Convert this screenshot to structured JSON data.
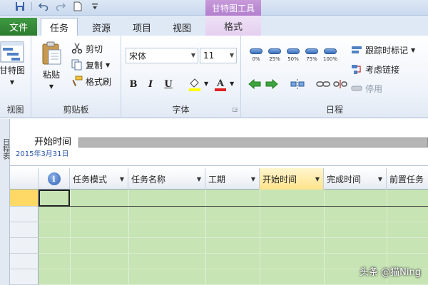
{
  "context_tab_header": "甘特图工具",
  "tabs": {
    "file": "文件",
    "task": "任务",
    "resource": "资源",
    "project": "项目",
    "view": "视图",
    "format": "格式"
  },
  "ribbon": {
    "view_group": {
      "button_label": "甘特图",
      "label": "视图"
    },
    "clipboard": {
      "paste": "粘贴",
      "cut": "剪切",
      "copy": "复制",
      "format_painter": "格式刷",
      "label": "剪贴板"
    },
    "font": {
      "font_name": "宋体",
      "font_size": "11",
      "bold": "B",
      "italic": "I",
      "underline": "U",
      "label": "字体"
    },
    "schedule": {
      "percent_buttons": [
        "0%",
        "25%",
        "50%",
        "75%",
        "100%"
      ],
      "mark_on_track": "跟踪时标记",
      "respect_links": "考虑链接",
      "inactivate": "停用",
      "label": "日程"
    }
  },
  "timeline": {
    "side_label": "日程表",
    "start_label": "开始时间",
    "start_date": "2015年3月31日"
  },
  "grid": {
    "info_symbol": "i",
    "columns": [
      "任务模式",
      "任务名称",
      "工期",
      "开始时间",
      "完成时间",
      "前置任务"
    ]
  },
  "watermark": "头条 @猫Ning",
  "colors": {
    "file_tab": "#2c7c2f",
    "context_tab": "#b27fce",
    "grid_fill": "#c6e4b4",
    "active_header": "#ffe38a",
    "timeline_bar": "#b5b5b5"
  }
}
